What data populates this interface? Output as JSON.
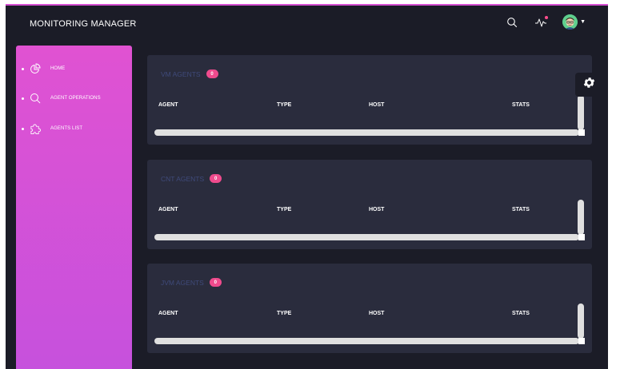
{
  "header": {
    "brand": "MONITORING MANAGER",
    "icons": [
      "search-icon",
      "activity-icon",
      "avatar-icon"
    ]
  },
  "sidebar": {
    "items": [
      {
        "label": "HOME",
        "icon": "pie-chart-icon"
      },
      {
        "label": "AGENT OPERATIONS",
        "icon": "search-icon"
      },
      {
        "label": "AGENTS LIST",
        "icon": "puzzle-icon"
      }
    ]
  },
  "panels": [
    {
      "title": "VM AGENTS",
      "count": "0",
      "columns": [
        "AGENT",
        "TYPE",
        "HOST",
        "STATS"
      ]
    },
    {
      "title": "CNT AGENTS",
      "count": "0",
      "columns": [
        "AGENT",
        "TYPE",
        "HOST",
        "STATS"
      ]
    },
    {
      "title": "JVM AGENTS",
      "count": "0",
      "columns": [
        "AGENT",
        "TYPE",
        "HOST",
        "STATS"
      ]
    }
  ],
  "colors": {
    "background": "#1b1c27",
    "sidebar_gradient_top": "#e052d2",
    "sidebar_gradient_bottom": "#c651dd",
    "panel": "#2a2c3d",
    "badge": "#ef4b8d"
  }
}
